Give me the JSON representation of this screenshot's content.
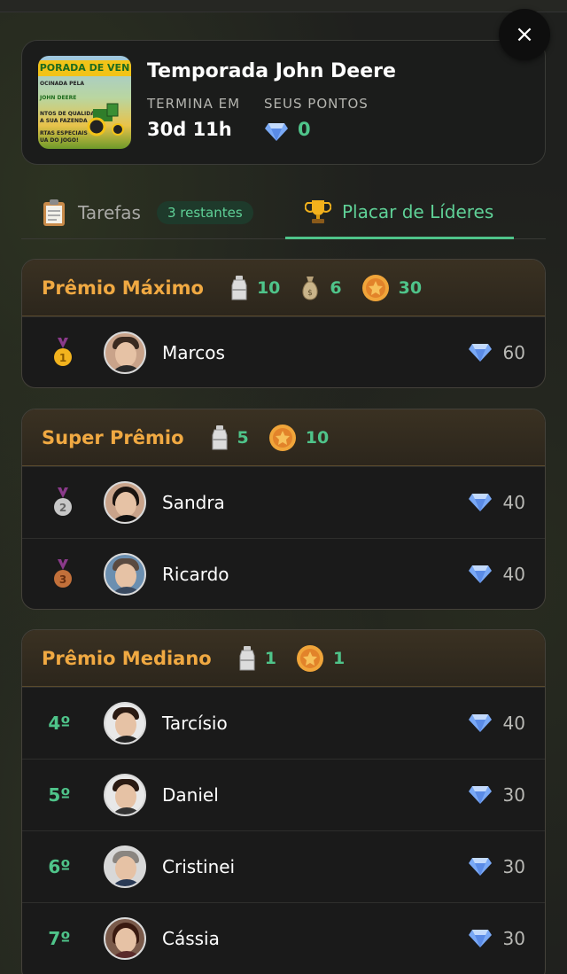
{
  "header": {
    "thumbnail_banner": "PORADA DE VEN",
    "thumbnail_lines": [
      "OCINADA PELA",
      "JOHN DEERE",
      "NTOS DE QUALIDADE",
      "A SUA FAZENDA",
      "RTAS ESPECIAIS",
      "UA DO JOGO!"
    ],
    "title": "Temporada John Deere",
    "ends_label": "TERMINA EM",
    "ends_value": "30d 11h",
    "points_label": "SEUS PONTOS",
    "points_value": "0",
    "close_label": "×"
  },
  "tabs": {
    "tasks_label": "Tarefas",
    "tasks_badge": "3 restantes",
    "leaderboard_label": "Placar de Líderes",
    "active": "leaderboard"
  },
  "tiers": [
    {
      "title": "Prêmio Máximo",
      "rewards": [
        {
          "icon": "milk-can-icon",
          "value": "10"
        },
        {
          "icon": "money-bag-icon",
          "value": "6"
        },
        {
          "icon": "gold-coin-icon",
          "value": "30"
        }
      ],
      "players": [
        {
          "rank": "1",
          "medal": "gold",
          "name": "Marcos",
          "score": "60"
        }
      ]
    },
    {
      "title": "Super Prêmio",
      "rewards": [
        {
          "icon": "milk-can-icon",
          "value": "5"
        },
        {
          "icon": "gold-coin-icon",
          "value": "10"
        }
      ],
      "players": [
        {
          "rank": "2",
          "medal": "silver",
          "name": "Sandra",
          "score": "40"
        },
        {
          "rank": "3",
          "medal": "bronze",
          "name": "Ricardo",
          "score": "40"
        }
      ]
    },
    {
      "title": "Prêmio Mediano",
      "rewards": [
        {
          "icon": "milk-can-icon",
          "value": "1"
        },
        {
          "icon": "gold-coin-icon",
          "value": "1"
        }
      ],
      "players": [
        {
          "rank": "4º",
          "medal": "",
          "name": "Tarcísio",
          "score": "40"
        },
        {
          "rank": "5º",
          "medal": "",
          "name": "Daniel",
          "score": "30"
        },
        {
          "rank": "6º",
          "medal": "",
          "name": "Cristinei",
          "score": "30"
        },
        {
          "rank": "7º",
          "medal": "",
          "name": "Cássia",
          "score": "30"
        }
      ]
    }
  ],
  "colors": {
    "accent_green": "#4fc48a",
    "tier_gold": "#f0a942",
    "background": "#1c1d1c"
  }
}
